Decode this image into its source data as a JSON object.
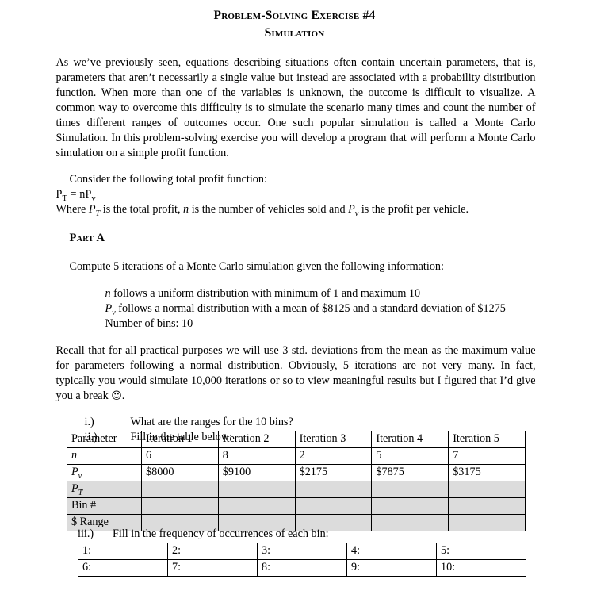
{
  "document": {
    "title_line_1": "Problem-Solving Exercise #4",
    "title_line_2": "Simulation",
    "intro_paragraph": "As we’ve previously seen, equations describing situations often contain uncertain parameters, that is, parameters that aren’t necessarily a single value but instead are associated with a probability distribution function.  When more than one of the variables is unknown, the outcome is difficult to visualize.  A common way to overcome this difficulty is to simulate the scenario many times and count the number of times different ranges of outcomes occur.  One such popular simulation is called a Monte Carlo Simulation.  In this problem-solving exercise you will develop a program that will perform a Monte Carlo simulation on a simple profit function.",
    "consider_line": "Consider the following total profit function:",
    "formula": "Pₜ = nPᵥ",
    "formula_parts": {
      "lhs_base": "P",
      "lhs_sub": "T",
      "equals": "=",
      "rhs_n": "n",
      "rhs_base": "P",
      "rhs_sub": "v"
    },
    "where_line": {
      "lead": "Where ",
      "pt_base": "P",
      "pt_sub": "T",
      "mid_1": " is the total profit, ",
      "n": "n",
      "mid_2": " is the number of vehicles sold and ",
      "pv_base": "P",
      "pv_sub": "v",
      "tail": " is the profit per vehicle."
    },
    "part_a_heading": "Part A",
    "compute_line": "Compute 5 iterations of a Monte Carlo simulation given the following information:",
    "assumptions": {
      "n_line": {
        "var": "n",
        "text": " follows a uniform distribution with minimum of 1 and maximum 10"
      },
      "pv_line": {
        "base": "P",
        "sub": "v",
        "text": " follows a normal distribution with a mean of  $8125 and a standard deviation of $1275"
      },
      "bins_line": "Number of bins:  10"
    },
    "recall_paragraph": "Recall that for all practical purposes we will use 3 std. deviations from the mean as the maximum value for parameters following a normal distribution. Obviously, 5 iterations are not very many. In fact, typically you would simulate 10,000 iterations or so to view meaningful results but I figured that I’d give you a break ",
    "recall_smiley": "☺",
    "recall_period": ".",
    "questions": [
      {
        "num": "i.)",
        "text": "What are the ranges for the 10 bins?"
      },
      {
        "num": "ii.)",
        "text": "Fill in the table below:"
      }
    ],
    "question_iii": {
      "num": "iii.)",
      "text": "Fill in the frequency of occurrences of each bin:"
    }
  },
  "main_table": {
    "headers": [
      "Parameter",
      "Iteration 1",
      "Iteration 2",
      "Iteration 3",
      "Iteration 4",
      "Iteration 5"
    ],
    "rows": [
      {
        "label": "n",
        "label_style": "italic",
        "shaded": false,
        "cells": [
          "6",
          "8",
          "2",
          "5",
          "7"
        ]
      },
      {
        "label": "P",
        "label_sub": "v",
        "label_style": "italic",
        "shaded": false,
        "cells": [
          "$8000",
          "$9100",
          "$2175",
          "$7875",
          "$3175"
        ]
      },
      {
        "label": "P",
        "label_sub": "T",
        "label_style": "italic",
        "shaded": true,
        "cells": [
          "",
          "",
          "",
          "",
          ""
        ]
      },
      {
        "label": "Bin #",
        "label_style": "normal",
        "shaded": true,
        "cells": [
          "",
          "",
          "",
          "",
          ""
        ]
      },
      {
        "label": "$ Range",
        "label_style": "normal",
        "shaded": true,
        "cells": [
          "",
          "",
          "",
          "",
          ""
        ]
      }
    ]
  },
  "bins_table": {
    "rows": [
      [
        "1:",
        "2:",
        "3:",
        "4:",
        "5:"
      ],
      [
        "6:",
        "7:",
        "8:",
        "9:",
        "10:"
      ]
    ]
  },
  "colors": {
    "text": "#000000",
    "page_background": "#ffffff",
    "table_border": "#000000",
    "shaded_row": "#dcdcdc"
  }
}
